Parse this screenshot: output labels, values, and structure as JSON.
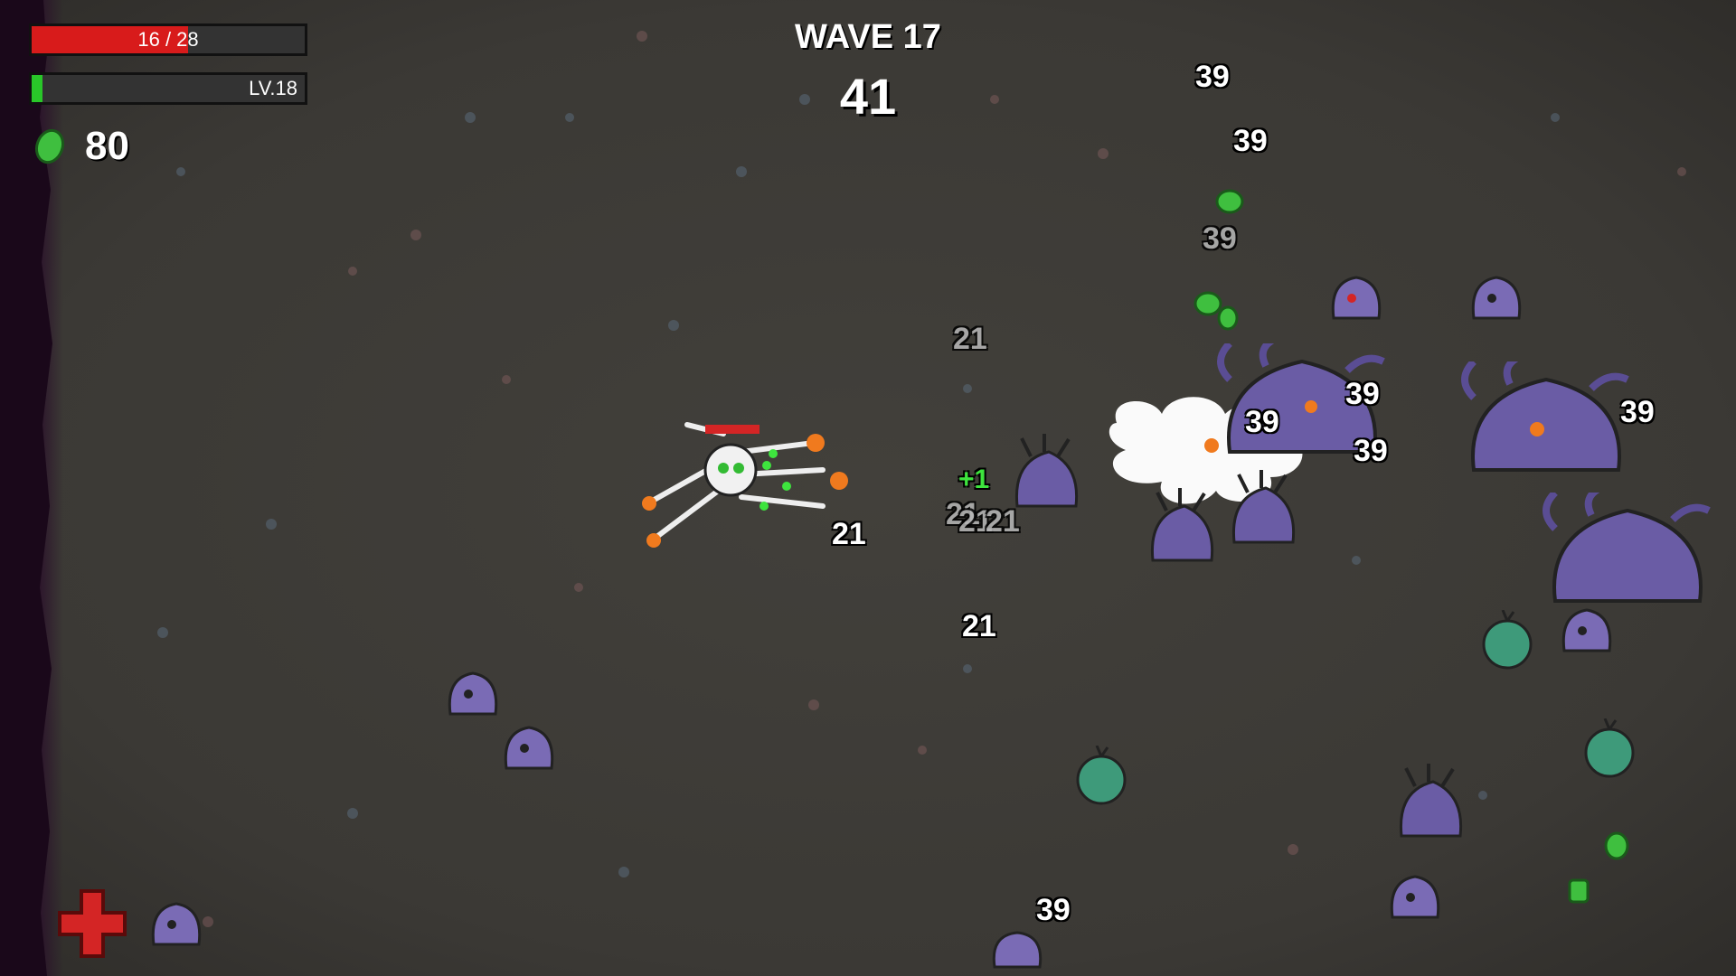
{
  "hud": {
    "hp": {
      "current": 16,
      "max": 28,
      "label": "16 / 28",
      "color": "#d81b1b"
    },
    "xp": {
      "label": "LV.18",
      "fill_fraction": 0.04,
      "color": "#29c729"
    },
    "materials": {
      "count": "80",
      "icon": "material-icon",
      "color": "#3fbf3f"
    }
  },
  "wave": {
    "title": "WAVE 17",
    "timer": "41"
  },
  "damage_numbers": [
    {
      "text": "39",
      "style": "normal"
    },
    {
      "text": "39",
      "style": "normal"
    },
    {
      "text": "39",
      "style": "faded"
    },
    {
      "text": "21",
      "style": "faded"
    },
    {
      "text": "39",
      "style": "normal"
    },
    {
      "text": "39",
      "style": "normal"
    },
    {
      "text": "39",
      "style": "normal"
    },
    {
      "text": "39",
      "style": "normal"
    },
    {
      "text": "21",
      "style": "normal"
    },
    {
      "text": "21",
      "style": "faded"
    },
    {
      "text": "21",
      "style": "faded"
    },
    {
      "text": "21",
      "style": "faded"
    },
    {
      "text": "21",
      "style": "normal"
    },
    {
      "text": "39",
      "style": "normal"
    },
    {
      "text": "+1",
      "style": "heal"
    }
  ],
  "colors": {
    "ground": "#3d3b37",
    "alien": "#7a6bb5",
    "alien_dark": "#5a4d94",
    "tree_enemy": "#3e9a7a",
    "projectile": "#f07a1e",
    "heal_cross": "#d42525"
  }
}
